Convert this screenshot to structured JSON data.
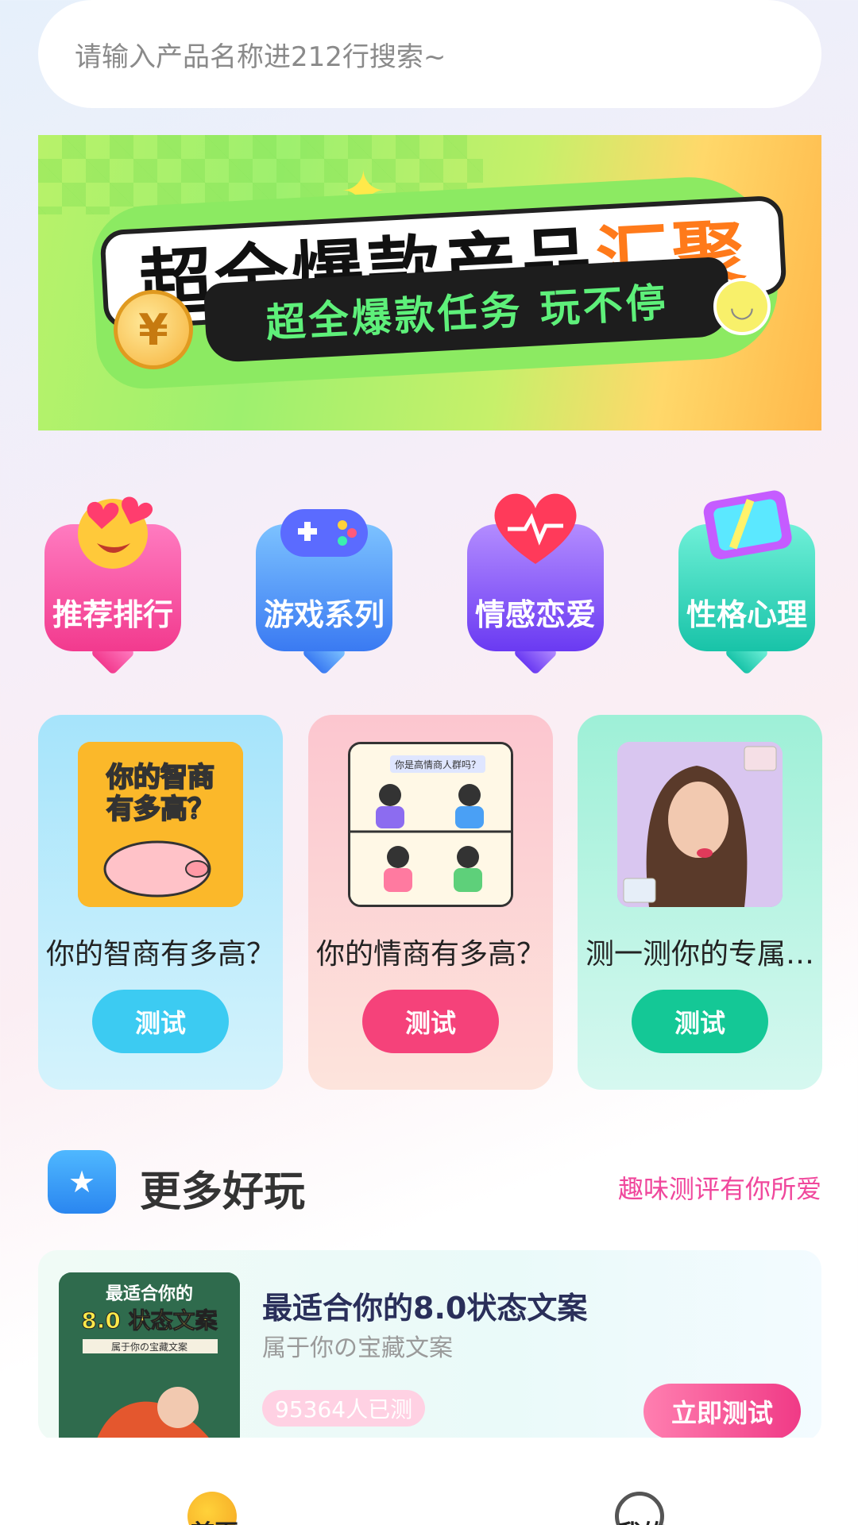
{
  "search": {
    "placeholder": "请输入产品名称进212行搜索~"
  },
  "banner": {
    "title_part1": "超全爆款产品",
    "title_part2": "汇聚",
    "subtitle": "超全爆款任务 玩不停"
  },
  "categories": [
    {
      "label": "推荐排行",
      "icon": "heart-eyes-emoji-icon"
    },
    {
      "label": "游戏系列",
      "icon": "gamepad-icon"
    },
    {
      "label": "情感恋爱",
      "icon": "heart-pulse-icon"
    },
    {
      "label": "性格心理",
      "icon": "monitor-icon"
    }
  ],
  "featured": [
    {
      "title": "你的智商有多高？",
      "button": "测试",
      "thumb_text": "你的智商有多高？"
    },
    {
      "title": "你的情商有多高？",
      "button": "测试",
      "thumb_text": "你是高情商人群吗？"
    },
    {
      "title": "测一测你的专属…",
      "button": "测试"
    }
  ],
  "section": {
    "title": "更多好玩",
    "tagline": "趣味测评有你所爱"
  },
  "list": [
    {
      "title": "最适合你的8.0状态文案",
      "subtitle": "属于你の宝藏文案",
      "count": "95364人已测",
      "button": "立即测试",
      "thumb_text_1": "最适合你的",
      "thumb_text_2": "8.0 状态文案",
      "thumb_text_3": "属于你の宝藏文案"
    }
  ],
  "bottom_nav": [
    {
      "label": "首页",
      "icon": "home-moon-icon"
    },
    {
      "label": "我的",
      "icon": "face-icon"
    }
  ],
  "colors": {
    "accent_pink": "#f0479c",
    "btn_blue": "#3ccbf2",
    "btn_red": "#f5427a",
    "btn_green": "#14c896"
  }
}
